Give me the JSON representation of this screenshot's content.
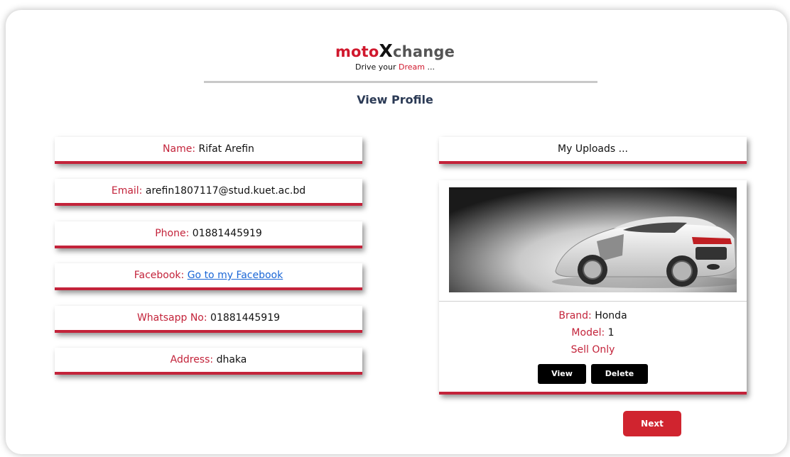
{
  "brand": {
    "part1": "moto",
    "part2": "X",
    "part3": "change",
    "tagline_pre": "Drive your ",
    "tagline_accent": "Dream",
    "tagline_post": " ..."
  },
  "page_title": "View Profile",
  "profile": [
    {
      "label": "Name:",
      "value": "Rifat Arefin"
    },
    {
      "label": "Email:",
      "value": "arefin1807117@stud.kuet.ac.bd"
    },
    {
      "label": "Phone:",
      "value": "01881445919"
    },
    {
      "label": "Facebook:",
      "value": "Go to my Facebook"
    },
    {
      "label": "Whatsapp No:",
      "value": "01881445919"
    },
    {
      "label": "Address:",
      "value": "dhaka"
    }
  ],
  "uploads": {
    "heading": "My Uploads ...",
    "item": {
      "brand_label": "Brand:",
      "brand_value": "Honda",
      "model_label": "Model:",
      "model_value": "1",
      "status": "Sell Only",
      "view_label": "View",
      "delete_label": "Delete"
    }
  },
  "next_label": "Next",
  "colors": {
    "accent": "#c3233a",
    "button_dark": "#000000",
    "next_button": "#d0242f",
    "link": "#1a66d6"
  }
}
